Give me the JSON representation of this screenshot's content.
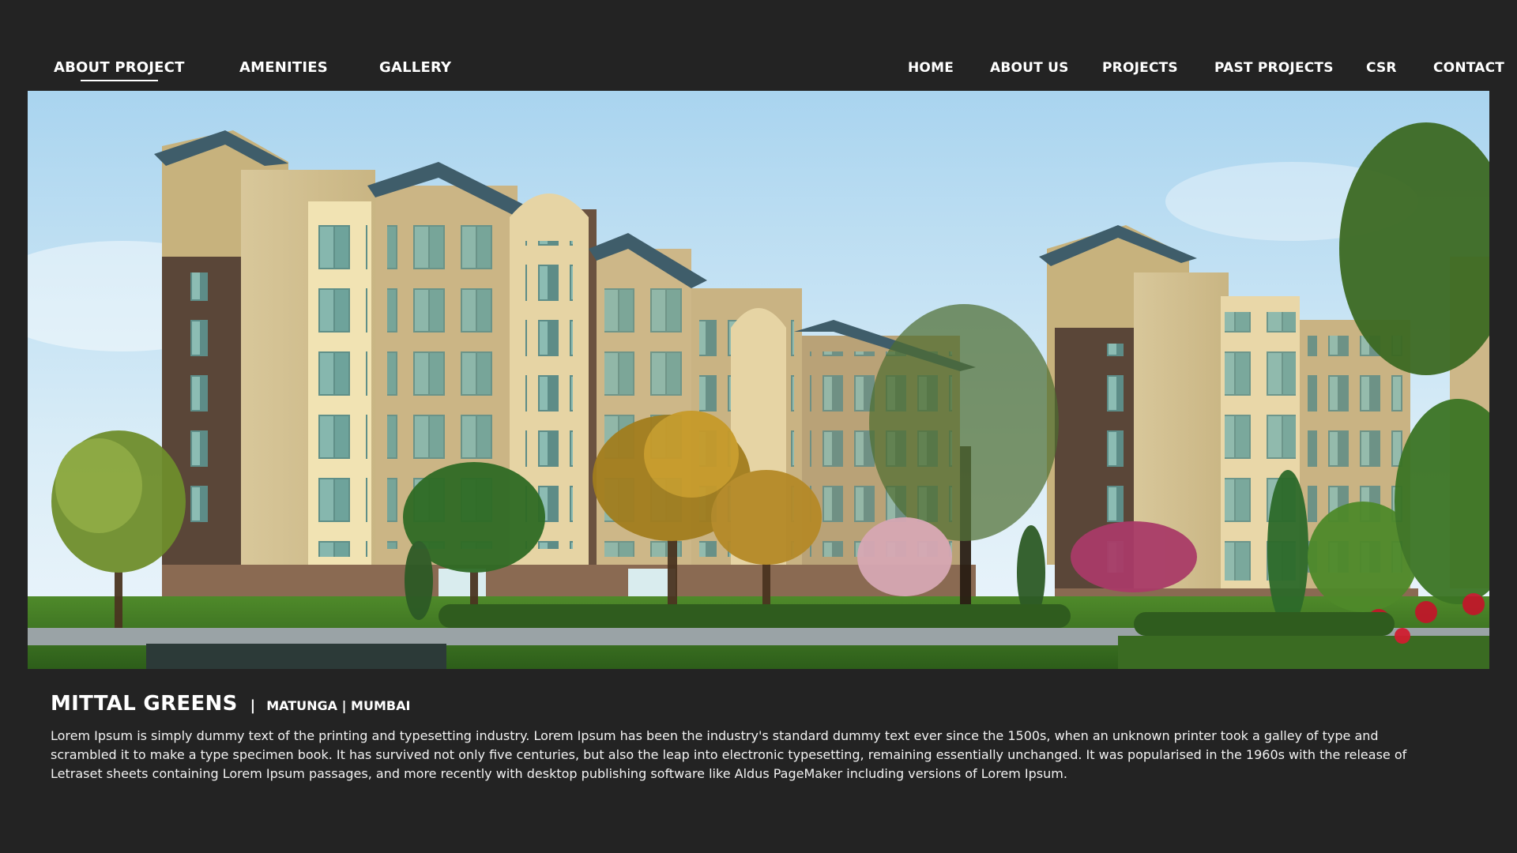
{
  "nav_left": {
    "items": [
      {
        "label": "ABOUT PROJECT",
        "active": true
      },
      {
        "label": "AMENITIES",
        "active": false
      },
      {
        "label": "GALLERY",
        "active": false
      }
    ]
  },
  "nav_right": {
    "items": [
      {
        "label": "HOME"
      },
      {
        "label": "ABOUT US"
      },
      {
        "label": "PROJECTS"
      },
      {
        "label": "PAST PROJECTS"
      },
      {
        "label": "CSR"
      },
      {
        "label": "CONTACT"
      }
    ]
  },
  "hero": {
    "image": "residential-buildings-rendering"
  },
  "project": {
    "name": "MITTAL GREENS",
    "separator": "|",
    "location": "MATUNGA | MUMBAI",
    "description": "Lorem Ipsum is simply dummy text of the printing and typesetting industry. Lorem Ipsum has been the industry's standard dummy text ever since the 1500s, when an unknown printer took a galley of type and scrambled it to make a type specimen book. It has survived not only five centuries, but also the leap into electronic typesetting, remaining essentially unchanged. It was popularised in the 1960s with the release of Letraset sheets containing Lorem Ipsum passages, and more recently with desktop publishing software like Aldus PageMaker including versions of Lorem Ipsum."
  },
  "colors": {
    "background": "#232323",
    "text": "#ffffff"
  }
}
